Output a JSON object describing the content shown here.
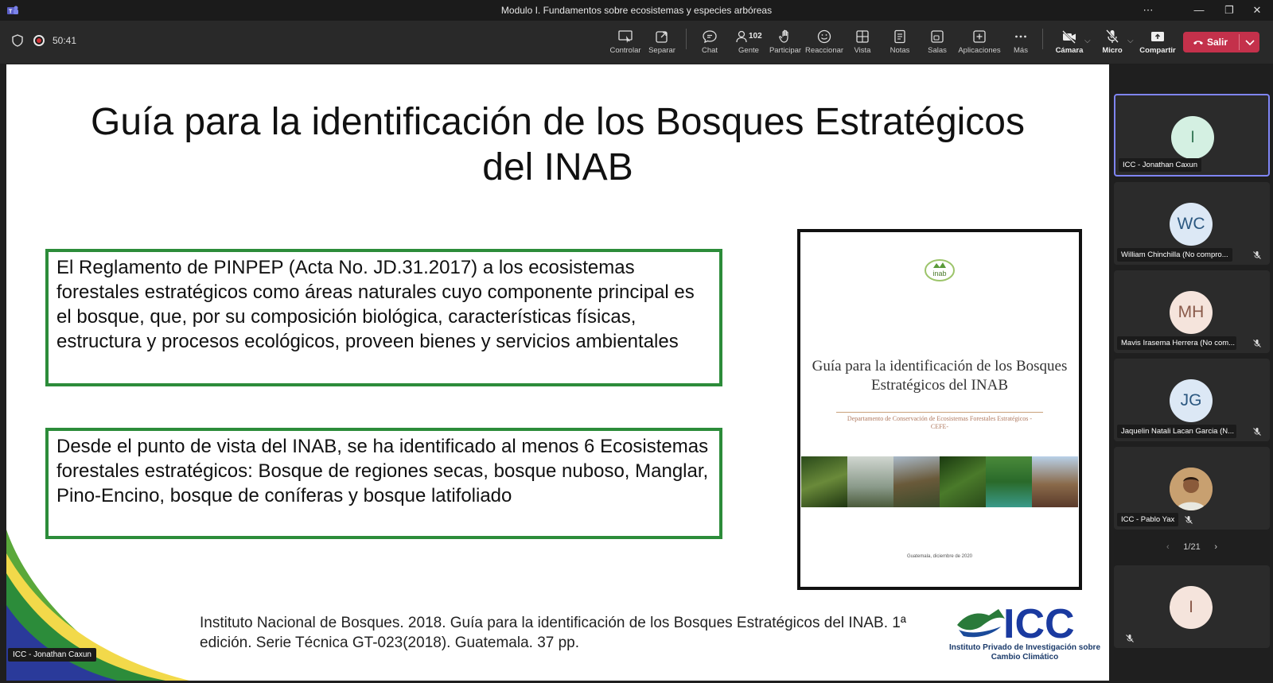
{
  "window": {
    "title": "Modulo I. Fundamentos sobre ecosistemas y especies arbóreas",
    "controls": [
      "⋯",
      "—",
      "❐",
      "✕"
    ]
  },
  "toolbar": {
    "timer": "50:41",
    "buttons": [
      {
        "label": "Controlar",
        "icon": "take-control-icon"
      },
      {
        "label": "Separar",
        "icon": "pop-out-icon"
      },
      {
        "label": "Chat",
        "icon": "chat-icon"
      },
      {
        "label": "Gente",
        "icon": "people-icon",
        "count": "102"
      },
      {
        "label": "Participar",
        "icon": "raise-hand-icon"
      },
      {
        "label": "Reaccionar",
        "icon": "react-icon"
      },
      {
        "label": "Vista",
        "icon": "view-icon"
      },
      {
        "label": "Notas",
        "icon": "notes-icon"
      },
      {
        "label": "Salas",
        "icon": "rooms-icon"
      },
      {
        "label": "Aplicaciones",
        "icon": "apps-icon"
      },
      {
        "label": "Más",
        "icon": "more-icon"
      },
      {
        "label": "Cámara",
        "icon": "camera-off-icon"
      },
      {
        "label": "Micro",
        "icon": "mic-off-icon"
      },
      {
        "label": "Compartir",
        "icon": "share-icon"
      }
    ],
    "leave_label": "Salir",
    "leave_color": "#c4314b"
  },
  "slide": {
    "title": "Guía para la identificación de los Bosques Estratégicos del INAB",
    "box1": "El Reglamento de PINPEP (Acta No. JD.31.2017) a los ecosistemas forestales estratégicos como áreas naturales cuyo componente principal es el bosque, que, por su composición biológica, características físicas, estructura y procesos ecológicos, proveen bienes y servicios ambientales",
    "box2": "Desde el punto de vista del INAB, se ha identificado al menos 6 Ecosistemas forestales estratégicos: Bosque de regiones secas, bosque nuboso, Manglar, Pino-Encino, bosque de coníferas y bosque latifoliado",
    "box_border_color": "#2c8c3a",
    "cover": {
      "logo_text": "inab",
      "title": "Guía para la identificación de los Bosques Estratégicos del INAB",
      "subtitle": "Departamento de Conservación de Ecosistemas Forestales Estratégicos -CEFE-",
      "date": "Guatemala, diciembre de 2020"
    },
    "reference": "Instituto Nacional de Bosques. 2018. Guía para la identificación de los Bosques Estratégicos del INAB. 1ª edición. Serie Técnica GT-023(2018). Guatemala. 37 pp.",
    "icc_logo_text": "ICC",
    "icc_subtitle": "Instituto Privado de Investigación sobre Cambio Climático",
    "speaker_label": "ICC - Jonathan Caxun"
  },
  "gallery": {
    "participants": [
      {
        "initials": "I",
        "name": "ICC - Jonathan Caxun",
        "muted": false,
        "active": true
      },
      {
        "initials": "WC",
        "name": "William Chinchilla (No compro...",
        "muted": true
      },
      {
        "initials": "MH",
        "name": "Mavis Irasema Herrera (No com...",
        "muted": true
      },
      {
        "initials": "JG",
        "name": "Jaquelin Natali Lacan Garcia (N...",
        "muted": true
      },
      {
        "initials": "",
        "name": "ICC - Pablo Yax",
        "muted": true,
        "photo": true
      }
    ],
    "pager": "1/21",
    "self_initials": "I"
  }
}
